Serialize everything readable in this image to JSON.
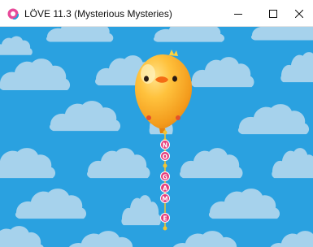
{
  "window": {
    "title": "LÖVE 11.3 (Mysterious Mysteries)",
    "icon": "love-logo-icon",
    "controls": [
      "minimize-icon",
      "maximize-icon",
      "close-icon"
    ]
  },
  "game": {
    "sky_color": "#2aa1e0",
    "cloud_color": "#a6d2ec",
    "balloon_color": "#f7a520",
    "balloon_highlight": "#ffd766",
    "string_bead_color": "#e63e7c",
    "connector_color": "#f3c431",
    "string_letters": [
      "N",
      "O",
      "G",
      "A",
      "M",
      "E"
    ]
  }
}
